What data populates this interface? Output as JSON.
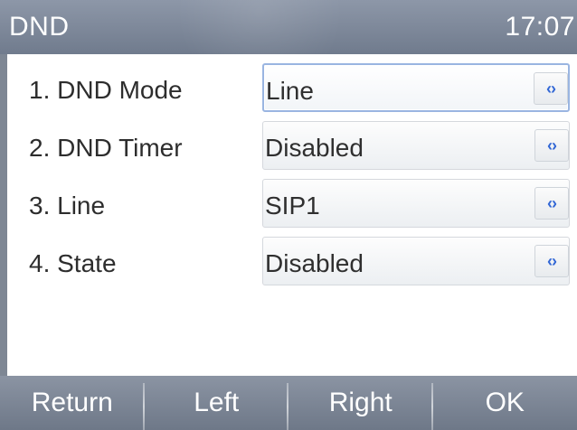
{
  "header": {
    "title": "DND",
    "time": "17:07"
  },
  "settings": {
    "rows": [
      {
        "label": "1. DND Mode",
        "value": "Line",
        "icon": "left-right-arrows-icon",
        "selected": true
      },
      {
        "label": "2. DND Timer",
        "value": "Disabled",
        "icon": "left-right-arrows-icon",
        "selected": false
      },
      {
        "label": "3. Line",
        "value": "SIP1",
        "icon": "left-right-arrows-icon",
        "selected": false
      },
      {
        "label": "4.  State",
        "value": "Disabled",
        "icon": "left-right-arrows-icon",
        "selected": false
      }
    ]
  },
  "softkeys": {
    "return": "Return",
    "left": "Left",
    "right": "Right",
    "ok": "OK"
  },
  "theme": {
    "header_bg": "#7d889a",
    "selection_border": "#9ab5e1",
    "arrow_color": "#3267d5",
    "panel_bg": "#ffffff"
  }
}
